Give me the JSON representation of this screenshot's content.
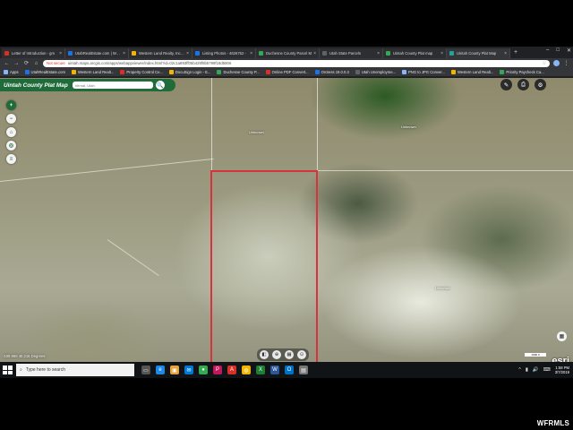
{
  "browser": {
    "tabs": [
      {
        "label": "Letter of Introduction - gm",
        "color": "#d93025"
      },
      {
        "label": "UtahRealEstate.com | WFR",
        "color": "#1a73e8"
      },
      {
        "label": "Western Land Realty, Inc. A",
        "color": "#f4b400"
      },
      {
        "label": "Listing Photos - 4626752 -",
        "color": "#1a73e8"
      },
      {
        "label": "Duchesne County Parcel M",
        "color": "#34a853"
      },
      {
        "label": "Utah State Parcels",
        "color": "#5f6368"
      },
      {
        "label": "Uintah County Plat map",
        "color": "#34a853"
      },
      {
        "label": "Uintah County Plat Map",
        "color": "#1fa39b",
        "active": true
      }
    ],
    "new_tab_icon": "+",
    "window_controls": [
      "–",
      "□",
      "✕"
    ],
    "nav": {
      "back": "←",
      "forward": "→",
      "reload": "⟳",
      "home": "⌂"
    },
    "not_secure_label": "Not secure",
    "url": "uintah.maps.arcgis.com/apps/webappviewer/index.html?id=02c1a893ff05b429f8b5799f18d5806",
    "star_icon": "☆",
    "bookmarks": [
      {
        "label": "Apps",
        "color": "#8ab4f8"
      },
      {
        "label": "UtahRealEstate.com",
        "color": "#1a73e8"
      },
      {
        "label": "Western Land Realt...",
        "color": "#f4b400"
      },
      {
        "label": "Property Control Ce...",
        "color": "#d93025"
      },
      {
        "label": "DocuSign Login - E...",
        "color": "#f4b400"
      },
      {
        "label": "Duchesne County P...",
        "color": "#34a853"
      },
      {
        "label": "Online PDF Convert...",
        "color": "#d93025"
      },
      {
        "label": "OnSess 19.0.0.3",
        "color": "#1a73e8"
      },
      {
        "label": "Utah Unemployme...",
        "color": "#5f6368"
      },
      {
        "label": "PNG to JPG Conver...",
        "color": "#8ab4f8"
      },
      {
        "label": "Western Land Realt...",
        "color": "#f4b400"
      },
      {
        "label": "Priority Paycheck Ca...",
        "color": "#34a853"
      }
    ]
  },
  "app": {
    "title": "Uintah County Plat Map",
    "search_placeholder": "Vernal, Utah",
    "search_icon": "🔍",
    "zoom_in": "+",
    "zoom_out": "−",
    "home_icon": "⌂",
    "locate_icon": "◎",
    "layers_icon": "≡",
    "tools": [
      "✎",
      "⎙",
      "⚙"
    ]
  },
  "map": {
    "labels": [
      "Unknown",
      "Unknown",
      "Unknown"
    ],
    "coordinates": "-109.968 40.216 Degrees",
    "scale": "1000 ft",
    "attribution": "esri",
    "attribution_small": "Powered by Esri",
    "bottom_bar_icons": [
      "◧",
      "⊕",
      "▦",
      "⊙"
    ],
    "parcel_color": "#d8323e"
  },
  "taskbar": {
    "search_label": "Type here to search",
    "apps": [
      {
        "glyph": "▭",
        "color": "#555"
      },
      {
        "glyph": "e",
        "color": "#1e88e5"
      },
      {
        "glyph": "▣",
        "color": "#e6a23c"
      },
      {
        "glyph": "✉",
        "color": "#0078d4"
      },
      {
        "glyph": "●",
        "color": "#34a853"
      },
      {
        "glyph": "P",
        "color": "#c2185b"
      },
      {
        "glyph": "A",
        "color": "#d93025"
      },
      {
        "glyph": "◍",
        "color": "#f4b400"
      },
      {
        "glyph": "X",
        "color": "#1e7e34"
      },
      {
        "glyph": "W",
        "color": "#2b579a"
      },
      {
        "glyph": "O",
        "color": "#0072c6"
      },
      {
        "glyph": "▤",
        "color": "#777"
      }
    ],
    "tray_icons": [
      "^",
      "▮",
      "🔊",
      "⌨"
    ],
    "time": "1:58 PM",
    "date": "3/7/2019"
  },
  "watermark": "WFRMLS"
}
